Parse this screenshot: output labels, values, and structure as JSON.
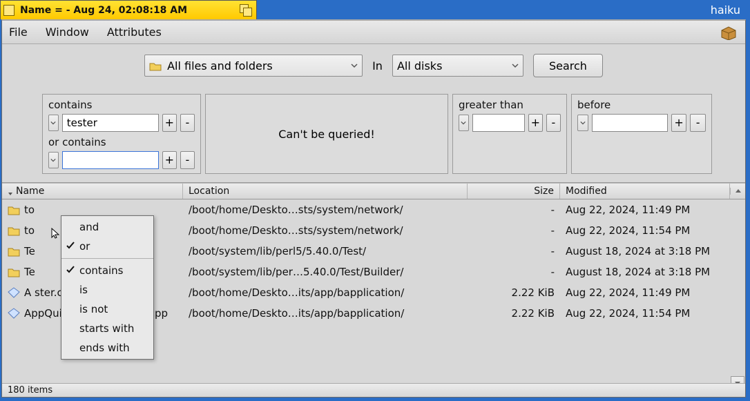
{
  "os_label": "haiku",
  "title": "Name =  - Aug 24, 02:08:18 AM",
  "menubar": {
    "file": "File",
    "window": "Window",
    "attributes": "Attributes"
  },
  "controls": {
    "type_label": "All files and folders",
    "in_label": "In",
    "disk_label": "All disks",
    "search_label": "Search"
  },
  "criteria": {
    "c1_label": "contains",
    "c1_value": "tester",
    "c2_label": "or contains",
    "c2_value": "",
    "center_msg": "Can't be queried!",
    "c3_label": "greater than",
    "c3_value": "",
    "c4_label": "before",
    "c4_value": "",
    "plus": "+",
    "minus": "-"
  },
  "dropdown": {
    "and": "and",
    "or": "or",
    "contains": "contains",
    "is": "is",
    "is_not": "is not",
    "starts_with": "starts with",
    "ends_with": "ends with"
  },
  "columns": {
    "name": "Name",
    "location": "Location",
    "size": "Size",
    "modified": "Modified"
  },
  "rows": [
    {
      "icon": "folder",
      "name": "to",
      "loc": "/boot/home/Deskto…sts/system/network/",
      "size": "-",
      "mod": "Aug 22, 2024, 11:49 PM"
    },
    {
      "icon": "folder",
      "name": "to",
      "loc": "/boot/home/Deskto…sts/system/network/",
      "size": "-",
      "mod": "Aug 22, 2024, 11:54 PM"
    },
    {
      "icon": "folder",
      "name": "Te",
      "loc": "/boot/system/lib/perl5/5.40.0/Test/",
      "size": "-",
      "mod": "August 18, 2024 at 3:18 PM"
    },
    {
      "icon": "folder",
      "name": "Te",
      "loc": "/boot/system/lib/per…5.40.0/Test/Builder/",
      "size": "-",
      "mod": "August 18, 2024 at 3:18 PM"
    },
    {
      "icon": "file",
      "name": "A                      ster.cpp",
      "loc": "/boot/home/Deskto…its/app/bapplication/",
      "size": "2.22 KiB",
      "mod": "Aug 22, 2024, 11:49 PM"
    },
    {
      "icon": "file",
      "name": "AppQuitRequ…edTester.cpp",
      "loc": "/boot/home/Deskto…its/app/bapplication/",
      "size": "2.22 KiB",
      "mod": "Aug 22, 2024, 11:54 PM"
    }
  ],
  "status": "180 items"
}
